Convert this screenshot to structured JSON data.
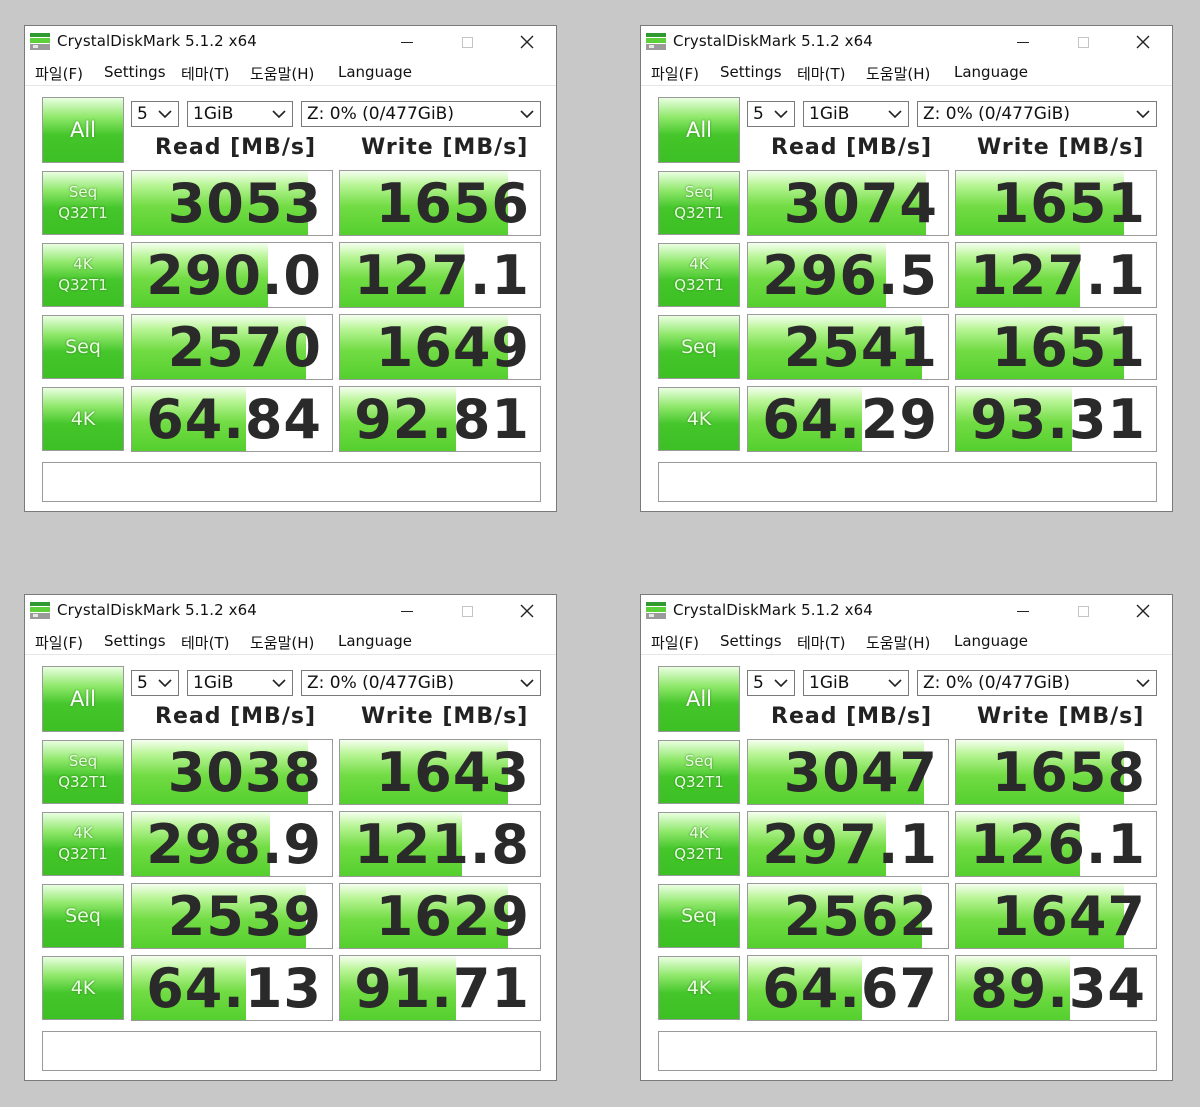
{
  "windows": [
    {
      "title": "CrystalDiskMark 5.1.2 x64",
      "menu": [
        "파일(F)",
        "Settings",
        "테마(T)",
        "도움말(H)",
        "Language"
      ],
      "all_label": "All",
      "count": "5",
      "size": "1GiB",
      "drive": "Z: 0% (0/477GiB)",
      "read_header": "Read [MB/s]",
      "write_header": "Write [MB/s]",
      "rows": [
        {
          "label1": "Seq",
          "label2": "Q32T1",
          "read": "3053",
          "write": "1656",
          "read_fill": 0.88,
          "write_fill": 0.84
        },
        {
          "label1": "4K",
          "label2": "Q32T1",
          "read": "290.0",
          "write": "127.1",
          "read_fill": 0.68,
          "write_fill": 0.62
        },
        {
          "label1": "Seq",
          "label2": "",
          "read": "2570",
          "write": "1649",
          "read_fill": 0.87,
          "write_fill": 0.84
        },
        {
          "label1": "4K",
          "label2": "",
          "read": "64.84",
          "write": "92.81",
          "read_fill": 0.57,
          "write_fill": 0.58
        }
      ]
    },
    {
      "title": "CrystalDiskMark 5.1.2 x64",
      "menu": [
        "파일(F)",
        "Settings",
        "테마(T)",
        "도움말(H)",
        "Language"
      ],
      "all_label": "All",
      "count": "5",
      "size": "1GiB",
      "drive": "Z: 0% (0/477GiB)",
      "read_header": "Read [MB/s]",
      "write_header": "Write [MB/s]",
      "rows": [
        {
          "label1": "Seq",
          "label2": "Q32T1",
          "read": "3074",
          "write": "1651",
          "read_fill": 0.89,
          "write_fill": 0.84
        },
        {
          "label1": "4K",
          "label2": "Q32T1",
          "read": "296.5",
          "write": "127.1",
          "read_fill": 0.69,
          "write_fill": 0.62
        },
        {
          "label1": "Seq",
          "label2": "",
          "read": "2541",
          "write": "1651",
          "read_fill": 0.87,
          "write_fill": 0.84
        },
        {
          "label1": "4K",
          "label2": "",
          "read": "64.29",
          "write": "93.31",
          "read_fill": 0.57,
          "write_fill": 0.58
        }
      ]
    },
    {
      "title": "CrystalDiskMark 5.1.2 x64",
      "menu": [
        "파일(F)",
        "Settings",
        "테마(T)",
        "도움말(H)",
        "Language"
      ],
      "all_label": "All",
      "count": "5",
      "size": "1GiB",
      "drive": "Z: 0% (0/477GiB)",
      "read_header": "Read [MB/s]",
      "write_header": "Write [MB/s]",
      "rows": [
        {
          "label1": "Seq",
          "label2": "Q32T1",
          "read": "3038",
          "write": "1643",
          "read_fill": 0.88,
          "write_fill": 0.84
        },
        {
          "label1": "4K",
          "label2": "Q32T1",
          "read": "298.9",
          "write": "121.8",
          "read_fill": 0.69,
          "write_fill": 0.61
        },
        {
          "label1": "Seq",
          "label2": "",
          "read": "2539",
          "write": "1629",
          "read_fill": 0.87,
          "write_fill": 0.84
        },
        {
          "label1": "4K",
          "label2": "",
          "read": "64.13",
          "write": "91.71",
          "read_fill": 0.57,
          "write_fill": 0.58
        }
      ]
    },
    {
      "title": "CrystalDiskMark 5.1.2 x64",
      "menu": [
        "파일(F)",
        "Settings",
        "테마(T)",
        "도움말(H)",
        "Language"
      ],
      "all_label": "All",
      "count": "5",
      "size": "1GiB",
      "drive": "Z: 0% (0/477GiB)",
      "read_header": "Read [MB/s]",
      "write_header": "Write [MB/s]",
      "rows": [
        {
          "label1": "Seq",
          "label2": "Q32T1",
          "read": "3047",
          "write": "1658",
          "read_fill": 0.88,
          "write_fill": 0.84
        },
        {
          "label1": "4K",
          "label2": "Q32T1",
          "read": "297.1",
          "write": "126.1",
          "read_fill": 0.69,
          "write_fill": 0.62
        },
        {
          "label1": "Seq",
          "label2": "",
          "read": "2562",
          "write": "1647",
          "read_fill": 0.87,
          "write_fill": 0.84
        },
        {
          "label1": "4K",
          "label2": "",
          "read": "64.67",
          "write": "89.34",
          "read_fill": 0.57,
          "write_fill": 0.57
        }
      ]
    }
  ],
  "colors": {
    "background": "#c8c8c8",
    "bar_green": "#54cf2e",
    "button_green": "#45c62b"
  }
}
